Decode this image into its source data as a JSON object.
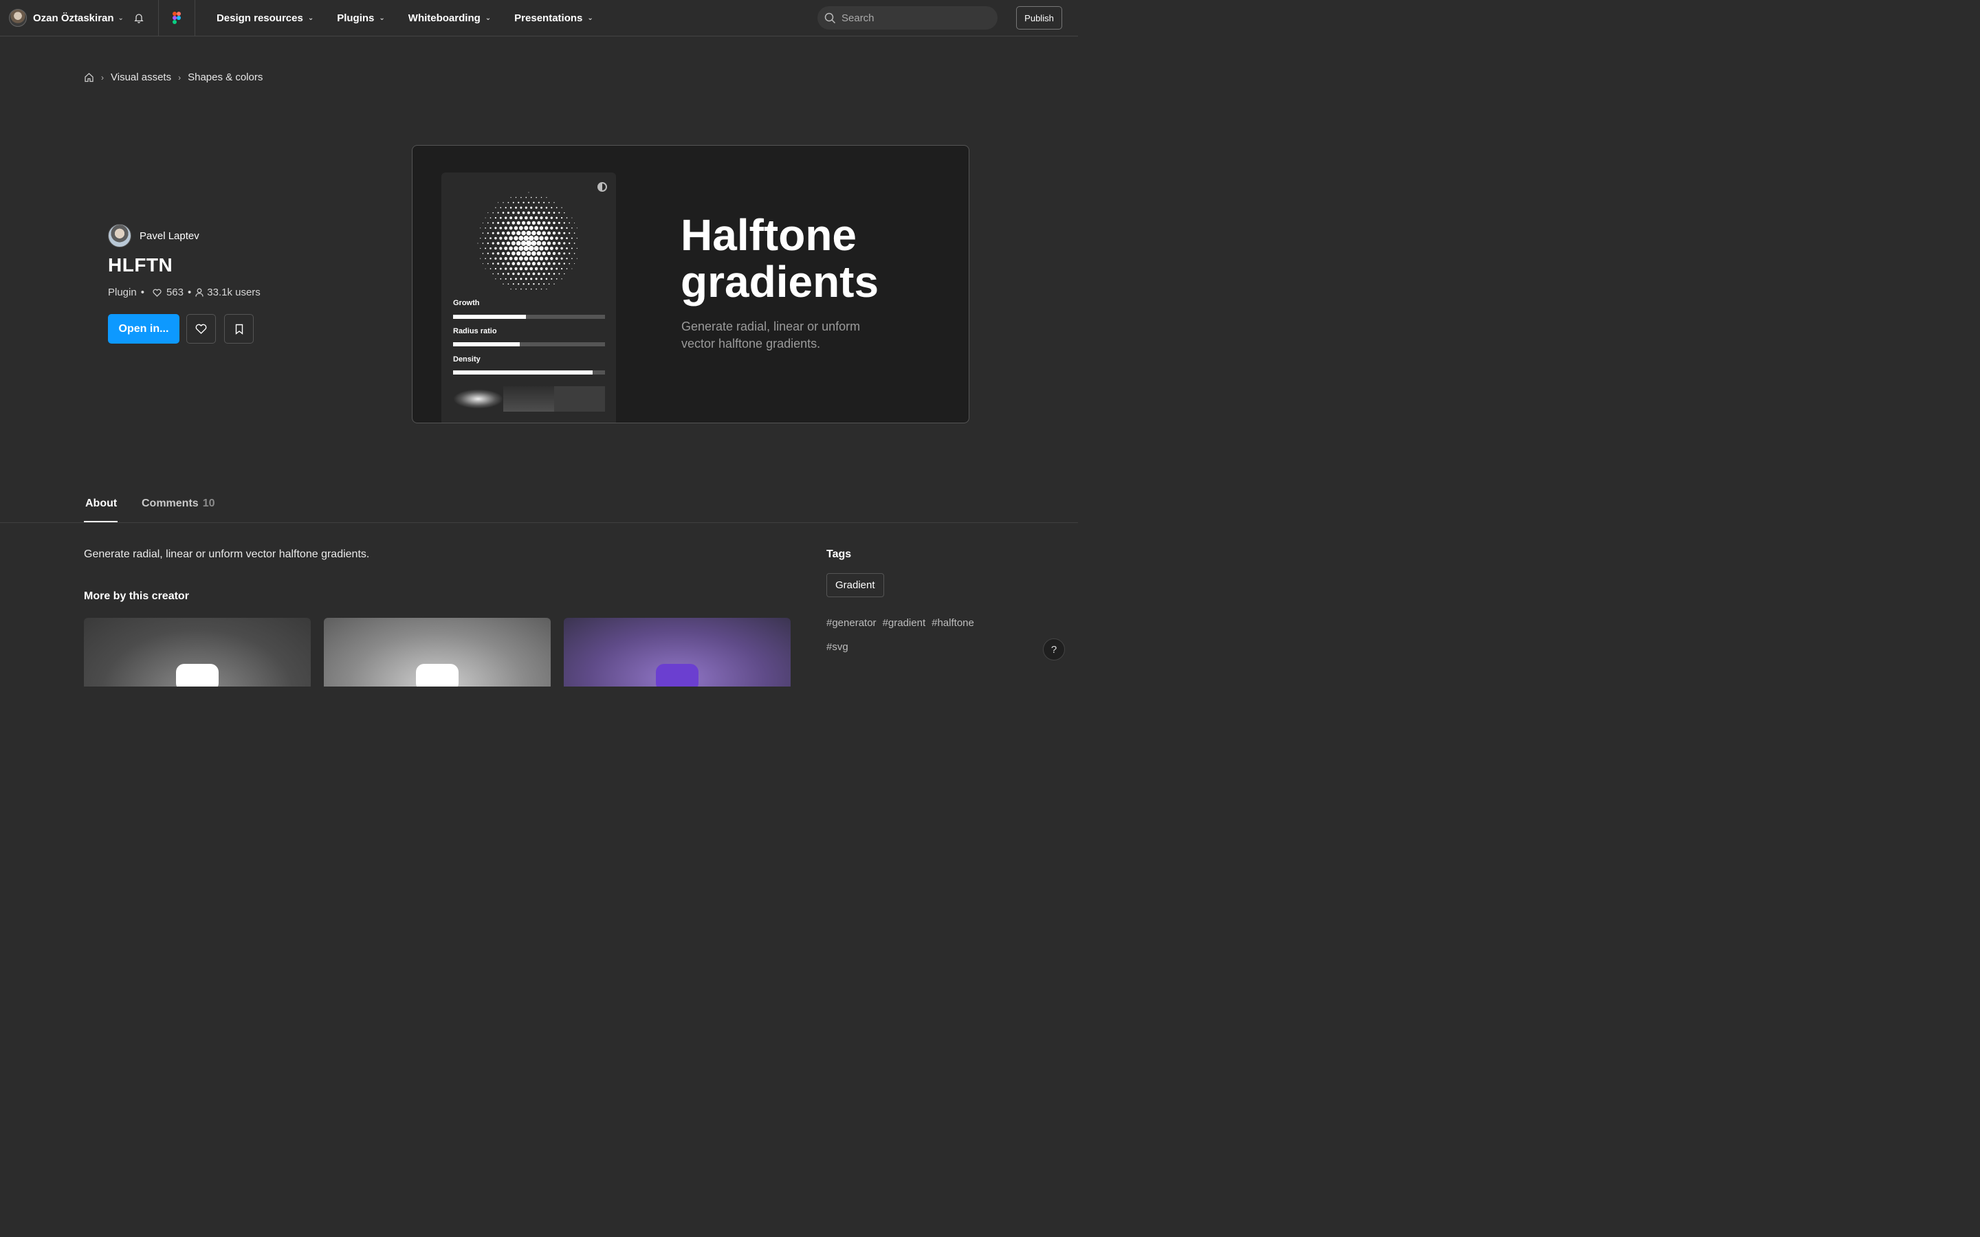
{
  "topnav": {
    "user_name": "Ozan Öztaskiran",
    "links": [
      "Design resources",
      "Plugins",
      "Whiteboarding",
      "Presentations"
    ],
    "search_placeholder": "Search",
    "publish_label": "Publish"
  },
  "breadcrumb": [
    "Visual assets",
    "Shapes & colors"
  ],
  "plugin": {
    "creator": "Pavel Laptev",
    "title": "HLFTN",
    "type": "Plugin",
    "likes": "563",
    "users": "33.1k users",
    "open_label": "Open in..."
  },
  "hero": {
    "title_line1": "Halftone",
    "title_line2": "gradients",
    "description": "Generate radial, linear or unform vector halftone gradients.",
    "sliders": [
      {
        "label": "Growth",
        "value": 0.48
      },
      {
        "label": "Radius ratio",
        "value": 0.44
      },
      {
        "label": "Density",
        "value": 0.92
      }
    ]
  },
  "tabs": {
    "about": "About",
    "comments": "Comments",
    "comments_count": "10"
  },
  "about": {
    "text": "Generate radial, linear or unform vector halftone gradients.",
    "more_title": "More by this creator"
  },
  "tags": {
    "title": "Tags",
    "chip": "Gradient",
    "hashtags": [
      "#generator",
      "#gradient",
      "#halftone",
      "#svg"
    ]
  },
  "help_label": "?",
  "colors": {
    "background": "#2c2c2c",
    "accent": "#0d99ff"
  }
}
